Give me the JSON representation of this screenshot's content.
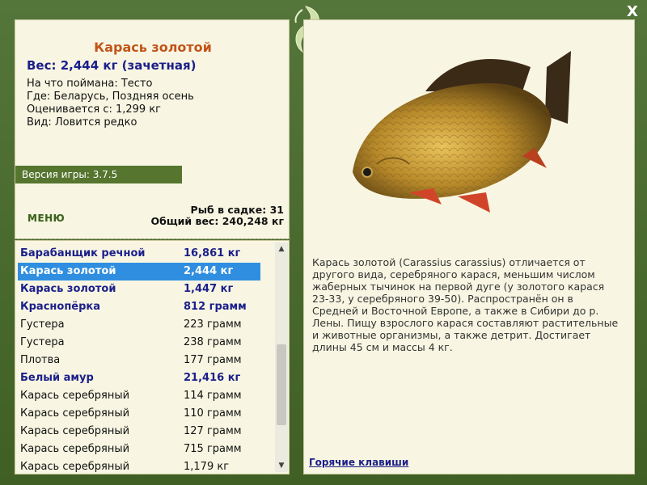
{
  "window": {
    "close_label": "X"
  },
  "fish": {
    "title": "Карась золотой",
    "weight": "Вес: 2,444 кг (зачетная)",
    "bait": "На что поймана: Тесто",
    "place": "Где: Беларусь, Поздняя осень",
    "rated_from": "Оценивается с: 1,299 кг",
    "kind": "Вид: Ловится редко"
  },
  "version": "Версия игры: 3.7.5",
  "menu_label": "МЕНЮ",
  "stats": {
    "count": "Рыб в садке: 31",
    "total": "Общий вес: 240,248 кг"
  },
  "catch_list": [
    {
      "name": "Барабанщик речной",
      "weight": "16,861 кг",
      "style": "bold"
    },
    {
      "name": "Карась золотой",
      "weight": "2,444 кг",
      "style": "selected"
    },
    {
      "name": "Карась золотой",
      "weight": "1,447 кг",
      "style": "bold"
    },
    {
      "name": "Краснопёрка",
      "weight": "812 грамм",
      "style": "bold"
    },
    {
      "name": "Густера",
      "weight": "223 грамм",
      "style": "normal"
    },
    {
      "name": "Густера",
      "weight": "238 грамм",
      "style": "normal"
    },
    {
      "name": "Плотва",
      "weight": "177 грамм",
      "style": "normal"
    },
    {
      "name": "Белый амур",
      "weight": "21,416 кг",
      "style": "bold"
    },
    {
      "name": "Карась серебряный",
      "weight": "114 грамм",
      "style": "normal"
    },
    {
      "name": "Карась серебряный",
      "weight": "110 грамм",
      "style": "normal"
    },
    {
      "name": "Карась серебряный",
      "weight": "127 грамм",
      "style": "normal"
    },
    {
      "name": "Карась серебряный",
      "weight": "715 грамм",
      "style": "normal"
    },
    {
      "name": "Карась серебряный",
      "weight": "1,179 кг",
      "style": "normal"
    }
  ],
  "description": "Карась золотой (Carassius carassius) отличается от другого вида, серебряного карася, меньшим числом жаберных тычинок на первой дуге (у золотого карася 23-33, у серебряного 39-50). Распространён он в Средней и Восточной Европе, а также в Сибири до р. Лены. Пищу взрослого карася составляют растительные и животные организмы, а также детрит. Достигает длины 45 см и массы 4 кг.",
  "hotkeys_label": "Горячие клавиши",
  "colors": {
    "frame": "#4a6b2e",
    "panel": "#f8f6e2",
    "title": "#c2541a",
    "accent_text": "#1b1f8a",
    "selection": "#2f8ee0"
  }
}
